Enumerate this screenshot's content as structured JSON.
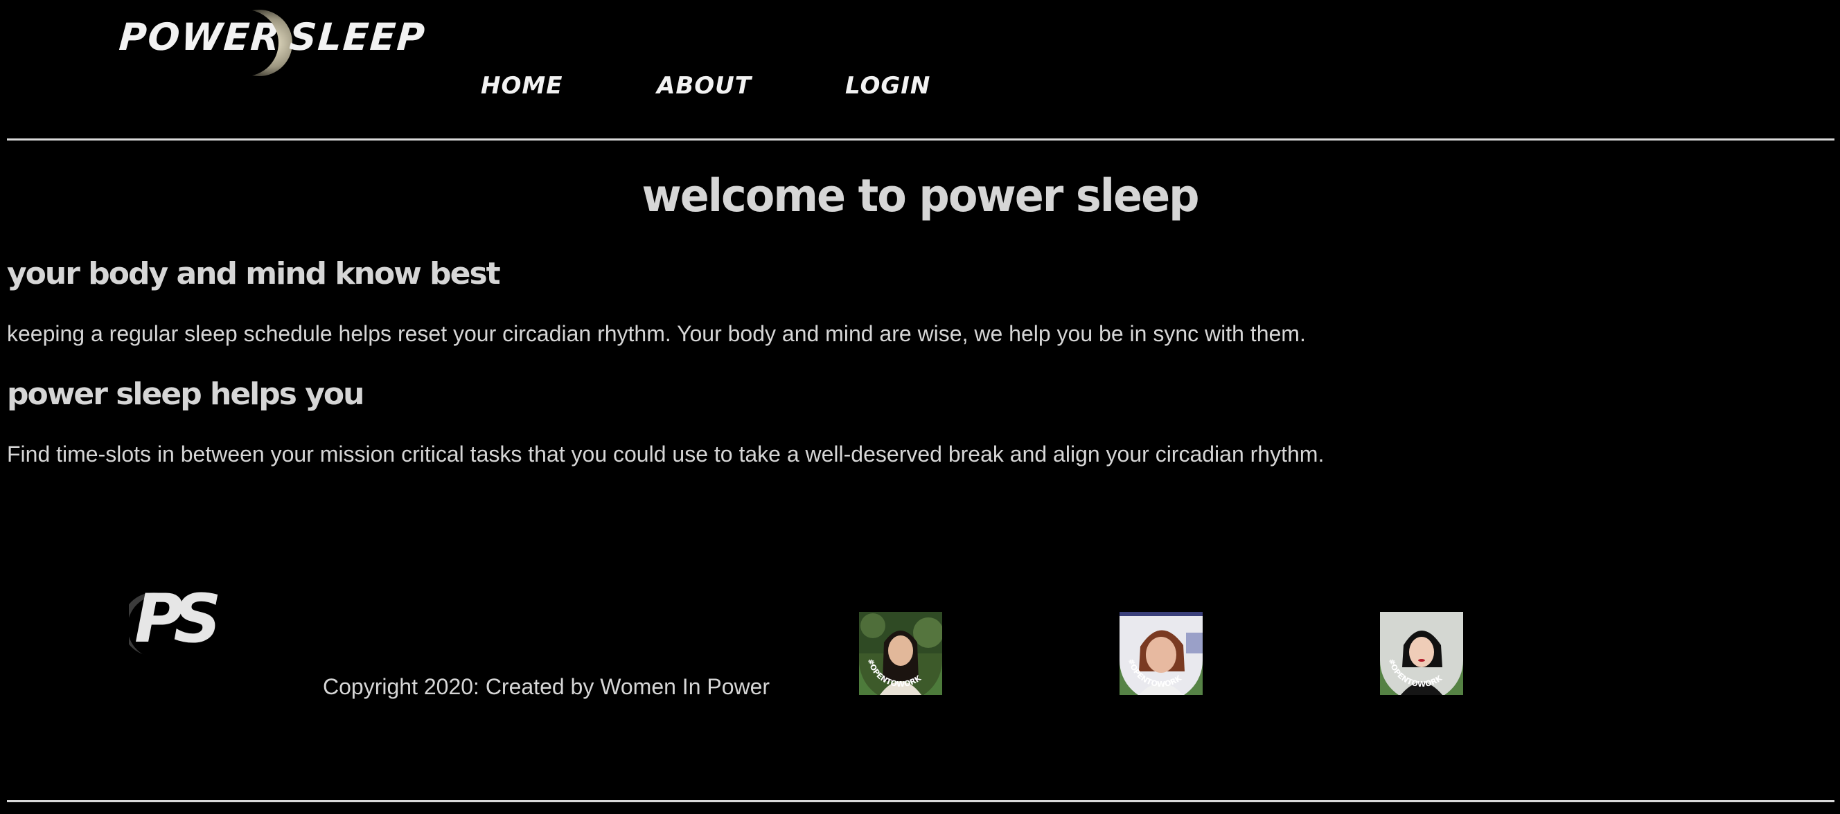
{
  "brand": {
    "logo_word_left": "POWER",
    "logo_word_right": "SLEEP",
    "footer_logo": "PS"
  },
  "nav": {
    "items": [
      {
        "label": "HOME"
      },
      {
        "label": "ABOUT"
      },
      {
        "label": "LOGIN"
      }
    ]
  },
  "main": {
    "title": "welcome to power sleep",
    "sections": [
      {
        "heading": "your body and mind know best",
        "text": "keeping a regular sleep schedule helps reset your circadian rhythm. Your body and mind are wise, we help you be in sync with them."
      },
      {
        "heading": "power sleep helps you",
        "text": "Find time-slots in between your mission critical tasks that you could use to take a well-deserved break and align your circadian rhythm."
      }
    ]
  },
  "footer": {
    "copyright": "Copyright 2020: Created by Women In Power",
    "avatars": [
      {
        "badge": "#OPENTOWORK"
      },
      {
        "badge": "#OPENTOWORK"
      },
      {
        "badge": "#OPENTOWORK"
      }
    ]
  },
  "colors": {
    "background": "#000000",
    "text": "#d6d6d6",
    "open_to_work_green": "#4e7d3c"
  }
}
